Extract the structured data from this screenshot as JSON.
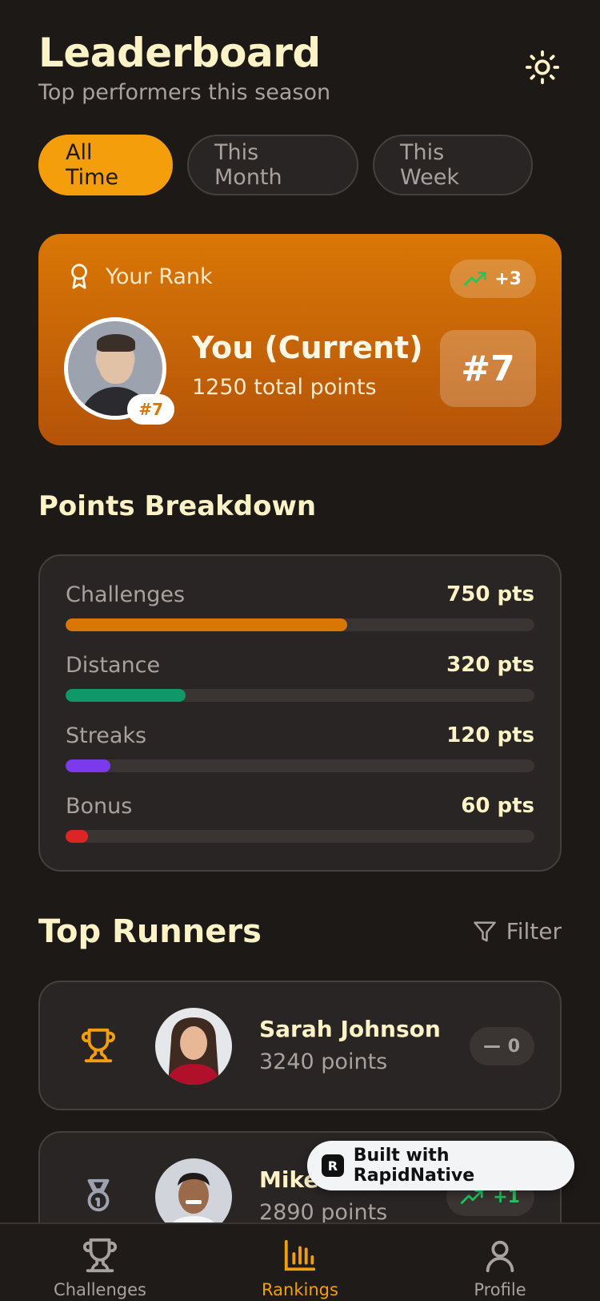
{
  "header": {
    "title": "Leaderboard",
    "subtitle": "Top performers this season",
    "theme_icon": "sun-icon"
  },
  "tabs": [
    {
      "label": "All Time",
      "active": true
    },
    {
      "label": "This Month",
      "active": false
    },
    {
      "label": "This Week",
      "active": false
    }
  ],
  "your_rank": {
    "label": "Your Rank",
    "change": "+3",
    "name": "You (Current)",
    "points": "1250 total points",
    "rank": "#7",
    "badge": "#7"
  },
  "breakdown": {
    "title": "Points Breakdown",
    "items": [
      {
        "label": "Challenges",
        "value": "750 pts",
        "fraction": 0.6,
        "color": "#d97706"
      },
      {
        "label": "Distance",
        "value": "320 pts",
        "fraction": 0.256,
        "color": "#10976a"
      },
      {
        "label": "Streaks",
        "value": "120 pts",
        "fraction": 0.096,
        "color": "#7c3aed"
      },
      {
        "label": "Bonus",
        "value": "60 pts",
        "fraction": 0.048,
        "color": "#dc2626"
      }
    ]
  },
  "runners": {
    "title": "Top Runners",
    "filter_label": "Filter",
    "list": [
      {
        "name": "Sarah Johnson",
        "points": "3240 points",
        "change": "0",
        "trend": "none",
        "icon": "trophy-icon"
      },
      {
        "name": "Mike",
        "points": "2890 points",
        "change": "+1",
        "trend": "up",
        "icon": "medal-icon"
      }
    ]
  },
  "built_with": "Built with RapidNative",
  "tabbar": {
    "items": [
      {
        "label": "Challenges",
        "icon": "trophy-icon",
        "active": false
      },
      {
        "label": "Rankings",
        "icon": "bar-chart-icon",
        "active": true
      },
      {
        "label": "Profile",
        "icon": "user-icon",
        "active": false
      }
    ]
  },
  "colors": {
    "background": "#1c1917",
    "accent": "#f59e0b",
    "card": "#292524"
  }
}
